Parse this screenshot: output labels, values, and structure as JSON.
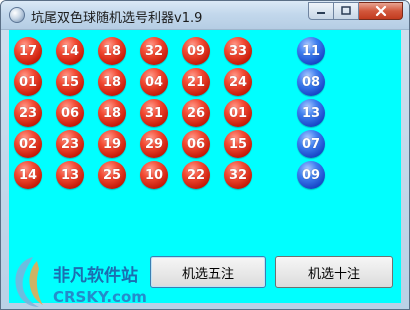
{
  "window": {
    "title": "坑尾双色球随机选号利器v1.9",
    "client_bg": "#00ffff"
  },
  "caption_buttons": {
    "icons": [
      "minimize-icon",
      "maximize-icon",
      "close-icon"
    ]
  },
  "red_balls": [
    [
      "17",
      "14",
      "18",
      "32",
      "09",
      "33"
    ],
    [
      "01",
      "15",
      "18",
      "04",
      "21",
      "24"
    ],
    [
      "23",
      "06",
      "18",
      "31",
      "26",
      "01"
    ],
    [
      "02",
      "23",
      "19",
      "29",
      "06",
      "15"
    ],
    [
      "14",
      "13",
      "25",
      "10",
      "22",
      "32"
    ]
  ],
  "blue_balls": [
    "11",
    "08",
    "13",
    "07",
    "09"
  ],
  "buttons": {
    "pick_five": "机选五注",
    "pick_ten": "机选十注"
  },
  "watermark": {
    "brand": "非凡软件站",
    "site": "CRSKY.com"
  },
  "colors": {
    "red_ball": "#e53318",
    "blue_ball": "#2a5fe0"
  }
}
